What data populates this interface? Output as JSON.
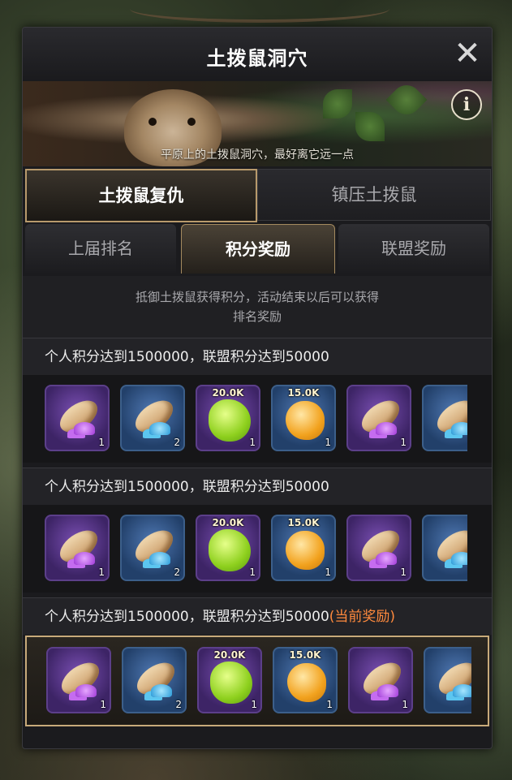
{
  "window": {
    "title": "土拨鼠洞穴",
    "close_icon": "close-icon",
    "info_icon": "info-icon"
  },
  "banner": {
    "caption": "平原上的土拨鼠洞穴，最好离它远一点"
  },
  "main_tabs": [
    {
      "label": "土拨鼠复仇",
      "active": true
    },
    {
      "label": "镇压土拨鼠",
      "active": false
    }
  ],
  "sub_tabs": [
    {
      "label": "上届排名",
      "active": false
    },
    {
      "label": "积分奖励",
      "active": true
    },
    {
      "label": "联盟奖励",
      "active": false
    }
  ],
  "description": {
    "line1": "抵御土拨鼠获得积分，活动结束以后可以获得",
    "line2": "排名奖励"
  },
  "tiers": [
    {
      "requirement": "个人积分达到1500000，联盟积分达到50000",
      "current_tag": "",
      "highlighted": false,
      "items": [
        {
          "icon": "bread-purple-mushroom-icon",
          "rarity": "purple",
          "qty": "1",
          "amount": ""
        },
        {
          "icon": "bread-blue-mushroom-icon",
          "rarity": "blue",
          "qty": "2",
          "amount": ""
        },
        {
          "icon": "green-slime-icon",
          "rarity": "purple",
          "qty": "1",
          "amount": "20.0K"
        },
        {
          "icon": "honey-drop-icon",
          "rarity": "blue",
          "qty": "1",
          "amount": "15.0K"
        },
        {
          "icon": "bread-purple-mushroom-icon",
          "rarity": "purple",
          "qty": "1",
          "amount": ""
        },
        {
          "icon": "bread-blue-mushroom-icon",
          "rarity": "blue",
          "qty": "",
          "amount": ""
        }
      ]
    },
    {
      "requirement": "个人积分达到1500000，联盟积分达到50000",
      "current_tag": "",
      "highlighted": false,
      "items": [
        {
          "icon": "bread-purple-mushroom-icon",
          "rarity": "purple",
          "qty": "1",
          "amount": ""
        },
        {
          "icon": "bread-blue-mushroom-icon",
          "rarity": "blue",
          "qty": "2",
          "amount": ""
        },
        {
          "icon": "green-slime-icon",
          "rarity": "purple",
          "qty": "1",
          "amount": "20.0K"
        },
        {
          "icon": "honey-drop-icon",
          "rarity": "blue",
          "qty": "1",
          "amount": "15.0K"
        },
        {
          "icon": "bread-purple-mushroom-icon",
          "rarity": "purple",
          "qty": "1",
          "amount": ""
        },
        {
          "icon": "bread-blue-mushroom-icon",
          "rarity": "blue",
          "qty": "",
          "amount": ""
        }
      ]
    },
    {
      "requirement": "个人积分达到1500000，联盟积分达到50000",
      "current_tag": "(当前奖励)",
      "highlighted": true,
      "items": [
        {
          "icon": "bread-purple-mushroom-icon",
          "rarity": "purple",
          "qty": "1",
          "amount": ""
        },
        {
          "icon": "bread-blue-mushroom-icon",
          "rarity": "blue",
          "qty": "2",
          "amount": ""
        },
        {
          "icon": "green-slime-icon",
          "rarity": "purple",
          "qty": "1",
          "amount": "20.0K"
        },
        {
          "icon": "honey-drop-icon",
          "rarity": "blue",
          "qty": "1",
          "amount": "15.0K"
        },
        {
          "icon": "bread-purple-mushroom-icon",
          "rarity": "purple",
          "qty": "1",
          "amount": ""
        },
        {
          "icon": "bread-blue-mushroom-icon",
          "rarity": "blue",
          "qty": "",
          "amount": ""
        }
      ]
    }
  ],
  "colors": {
    "accent_gold": "#b89a6c",
    "current_reward": "#ff8a3d",
    "rarity_purple": "#5c3f8a",
    "rarity_blue": "#3c5f8a"
  }
}
